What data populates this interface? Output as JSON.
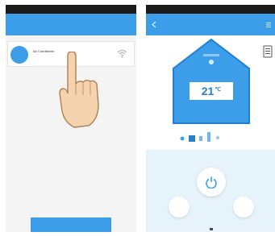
{
  "left_screen": {
    "title": "",
    "device": {
      "avatar_text": "",
      "name": "Air Conditioner",
      "subtitle": "",
      "wifi_icon": "wifi-icon"
    },
    "bottom_button_label": ""
  },
  "right_screen": {
    "title": "",
    "house_label": "",
    "temperature": {
      "value": "21",
      "unit": "℃"
    },
    "side_label": "",
    "mode_label": "",
    "mode_icons": [
      "fan-icon",
      "cool-icon",
      "dry-icon",
      "heat-icon",
      "auto-icon"
    ],
    "buttons": {
      "power": "power-icon",
      "left_label": "",
      "right_label": ""
    }
  },
  "colors": {
    "accent": "#3c9ee8",
    "status_bar": "#1b1b1b",
    "control_background": "#e6f3fb",
    "temperature_text": "#2b80c2"
  }
}
